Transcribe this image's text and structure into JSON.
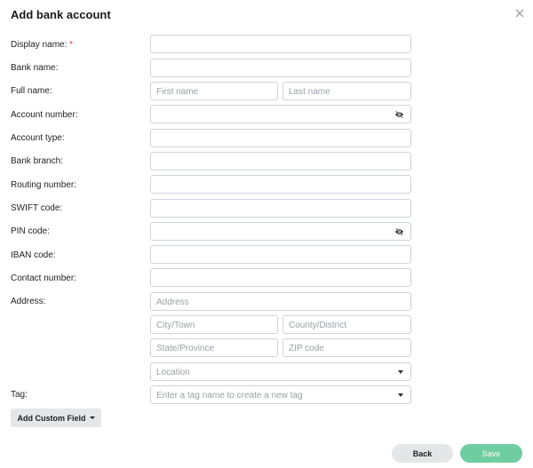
{
  "dialog": {
    "title": "Add bank account",
    "close_icon": "close-icon"
  },
  "labels": {
    "display_name": "Display name:",
    "required_mark": "*",
    "bank_name": "Bank name:",
    "full_name": "Full name:",
    "account_number": "Account number:",
    "account_type": "Account type:",
    "bank_branch": "Bank branch:",
    "routing_number": "Routing number:",
    "swift_code": "SWIFT code:",
    "pin_code": "PIN code:",
    "iban_code": "IBAN code:",
    "contact_number": "Contact number:",
    "address": "Address:",
    "tag": "Tag:"
  },
  "placeholders": {
    "first_name": "First name",
    "last_name": "Last name",
    "address": "Address",
    "city": "City/Town",
    "county": "County/District",
    "state": "State/Province",
    "zip": "ZIP code",
    "location": "Location",
    "tag": "Enter a tag name to create a new tag"
  },
  "icons": {
    "visibility": "eye-off-icon",
    "dropdown": "chevron-down-icon"
  },
  "buttons": {
    "add_custom_field": "Add Custom Field",
    "back": "Back",
    "save": "Save"
  },
  "colors": {
    "required": "#e03a3a",
    "save_button": "#4cc38a",
    "secondary_button": "#e5e6e8",
    "field_border": "#cfd3d8"
  }
}
